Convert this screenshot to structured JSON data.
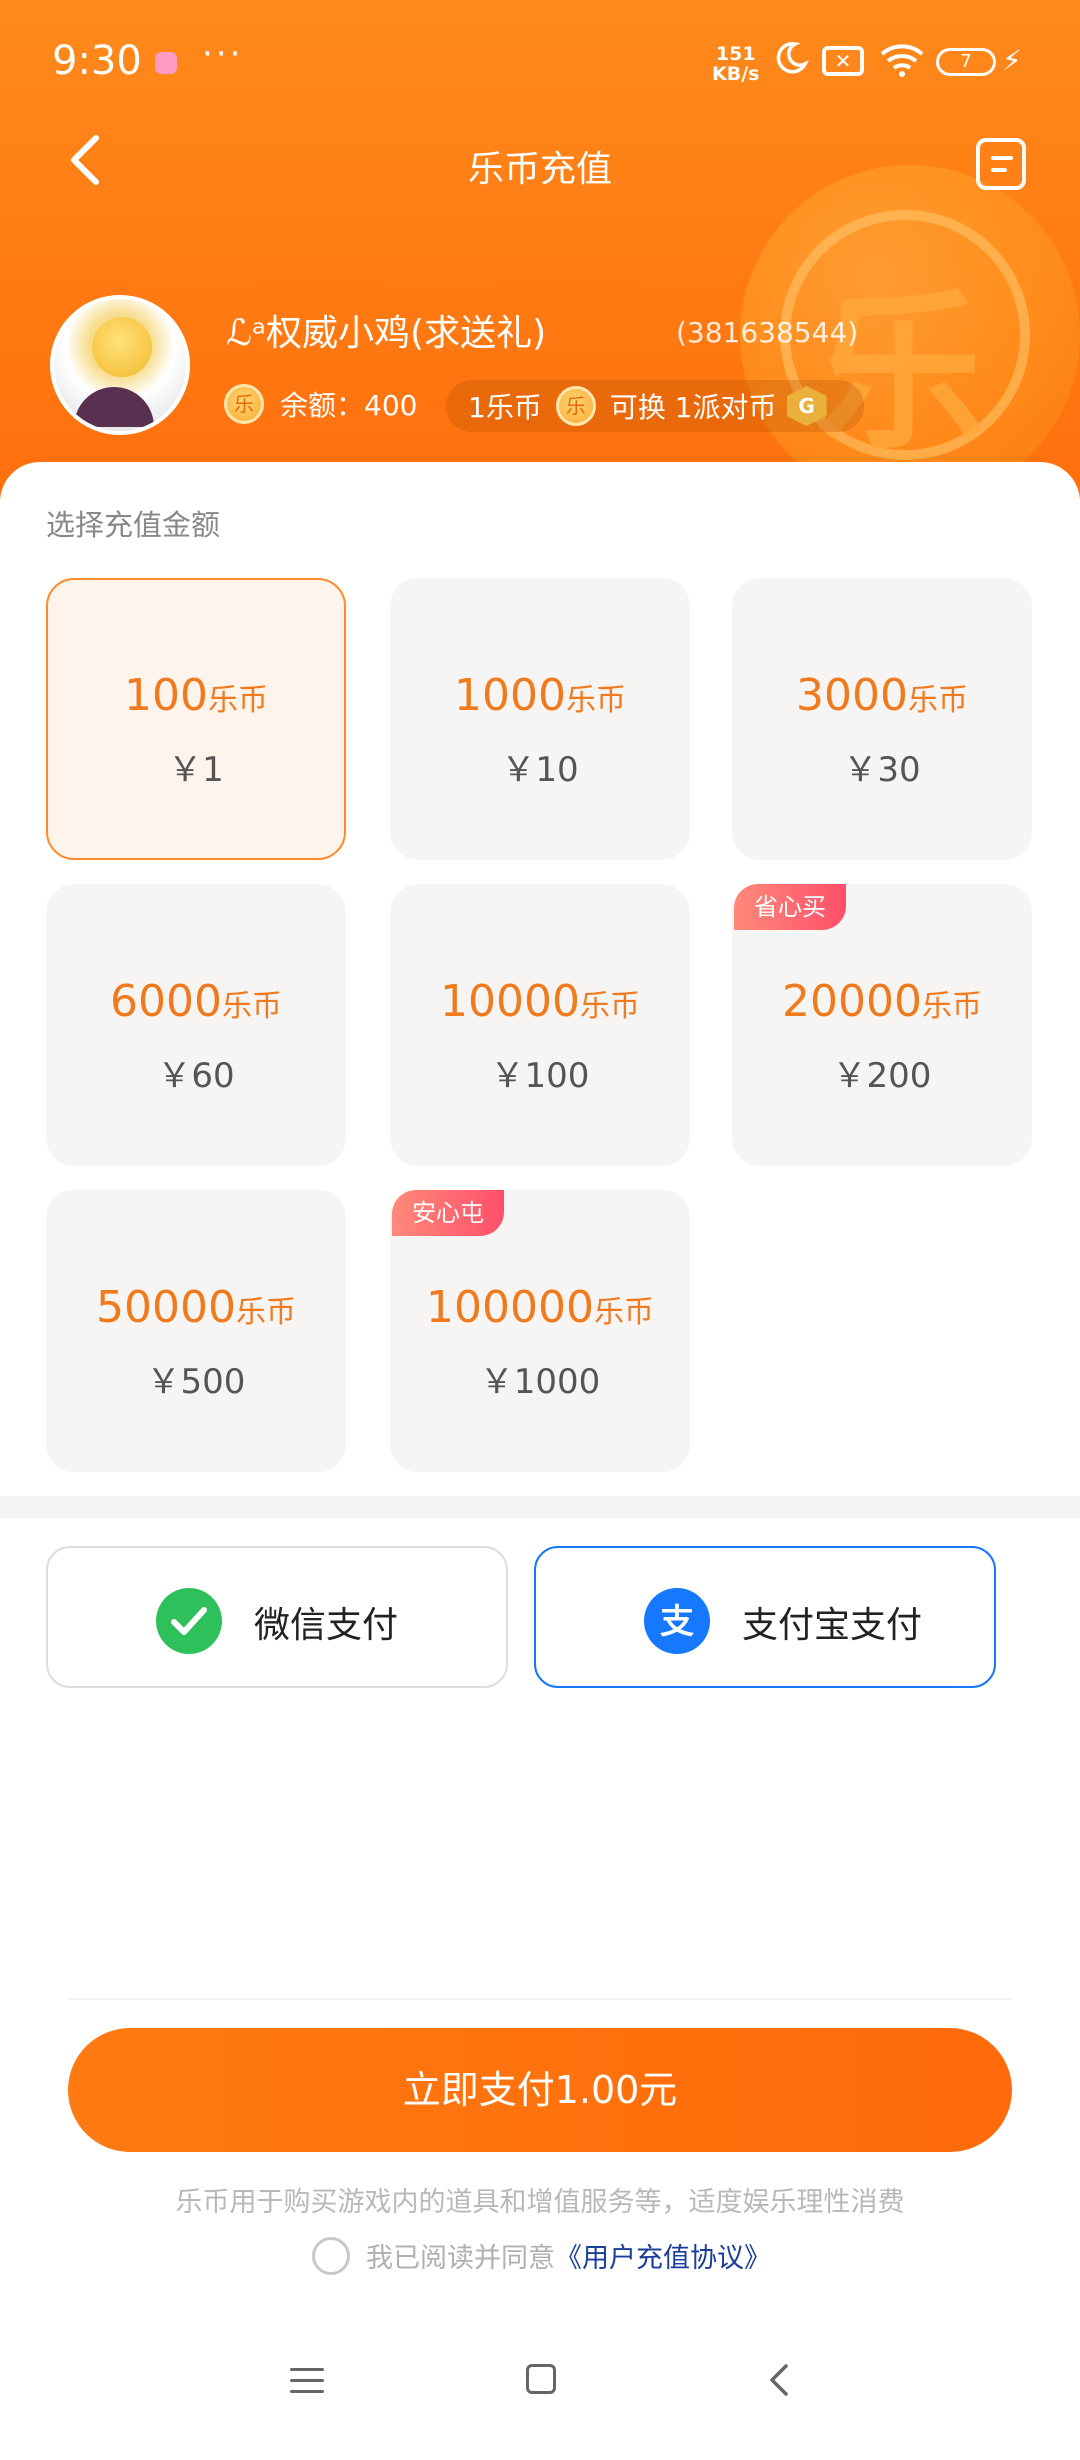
{
  "status_bar": {
    "time": "9:30",
    "more": "···",
    "net_speed_value": "151",
    "net_speed_unit": "KB/s",
    "battery": "7",
    "icons": [
      "app-notification-icon",
      "moon-icon",
      "sim-x-icon",
      "wifi-icon",
      "battery-icon",
      "charging-icon"
    ]
  },
  "nav": {
    "title": "乐币充值",
    "back_icon": "chevron-left-icon",
    "record_icon": "record-icon"
  },
  "user": {
    "name": "ℒᵃ权威小鸡(求送礼)",
    "id": "(381638544)",
    "balance_label": "余额：400",
    "coin_glyph": "乐",
    "exchange_left": "1乐币",
    "exchange_right": "可换 1派对币",
    "party_coin_glyph": "G"
  },
  "recharge": {
    "section_title": "选择充值金额",
    "unit": "乐币",
    "options": [
      {
        "coins": "100",
        "price": "￥1",
        "selected": true,
        "tag": ""
      },
      {
        "coins": "1000",
        "price": "￥10",
        "selected": false,
        "tag": ""
      },
      {
        "coins": "3000",
        "price": "￥30",
        "selected": false,
        "tag": ""
      },
      {
        "coins": "6000",
        "price": "￥60",
        "selected": false,
        "tag": ""
      },
      {
        "coins": "10000",
        "price": "￥100",
        "selected": false,
        "tag": ""
      },
      {
        "coins": "20000",
        "price": "￥200",
        "selected": false,
        "tag": "省心买"
      },
      {
        "coins": "50000",
        "price": "￥500",
        "selected": false,
        "tag": ""
      },
      {
        "coins": "100000",
        "price": "￥1000",
        "selected": false,
        "tag": "安心屯"
      }
    ]
  },
  "payment": {
    "wechat_label": "微信支付",
    "alipay_label": "支付宝支付",
    "alipay_glyph": "支",
    "selected": "alipay",
    "colors": {
      "wechat": "#2ec05a",
      "alipay": "#1677ff"
    }
  },
  "checkout": {
    "button_label": "立即支付1.00元",
    "note": "乐币用于购买游戏内的道具和增值服务等，适度娱乐理性消费",
    "agree_text": "我已阅读并同意",
    "agreement_link": "《用户充值协议》",
    "agreed": false
  },
  "colors": {
    "brand_orange": "#ff7a12",
    "coin_text_orange": "#f07a1e",
    "tag_pink": "#ff4f6a",
    "link_blue": "#1a3f9b"
  }
}
